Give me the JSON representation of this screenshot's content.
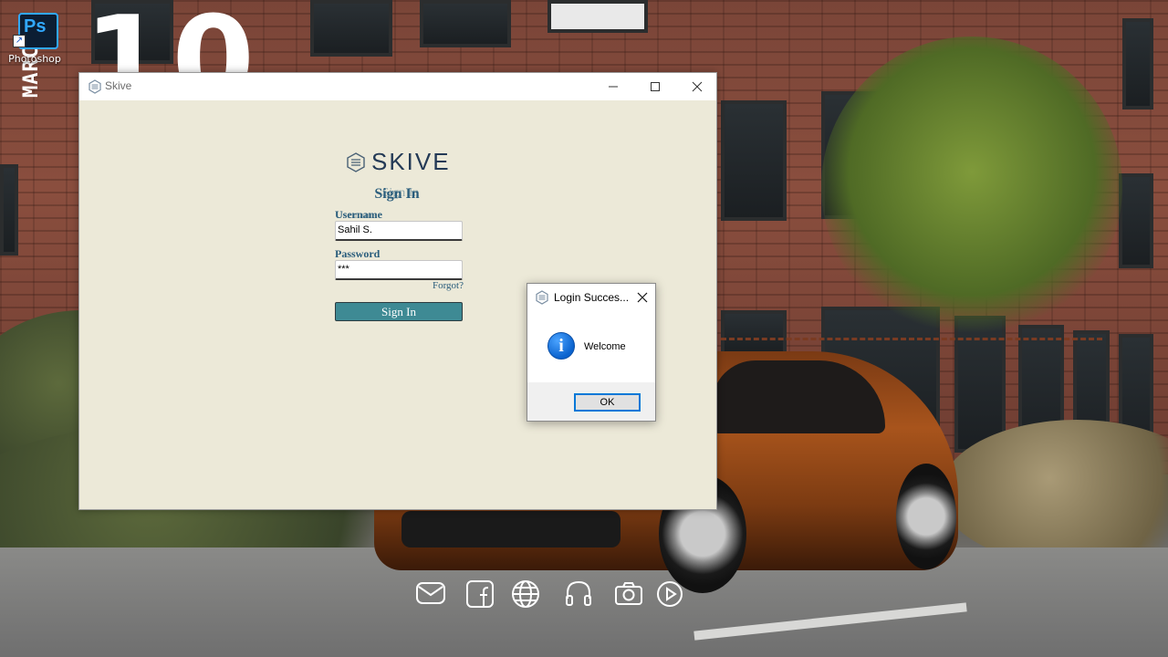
{
  "desktop": {
    "clock_big_text": "10",
    "month_text": "MARCH",
    "icons": [
      {
        "label": "Photoshop",
        "logo_text": "Ps",
        "icon": "photoshop-icon"
      }
    ],
    "dock": [
      {
        "icon": "mail-icon"
      },
      {
        "icon": "facebook-icon"
      },
      {
        "icon": "globe-icon"
      },
      {
        "icon": "headphones-icon"
      },
      {
        "icon": "camera-icon"
      },
      {
        "icon": "play-icon"
      }
    ]
  },
  "app": {
    "window_title": "Skive",
    "brand": "SKIVE",
    "heading": "Sign In",
    "username_label": "Username",
    "username_value": "Sahil S.",
    "password_label": "Password",
    "password_value": "***",
    "forgot_label": "Forgot?",
    "signin_button": "Sign In",
    "colors": {
      "background": "#ece9d8",
      "accent": "#3e8a94",
      "label_text": "#2a5d7c",
      "brand_text": "#243a56"
    }
  },
  "dialog": {
    "title": "Login Succes...",
    "message": "Welcome",
    "ok_button": "OK",
    "icon": "info-icon",
    "colors": {
      "info_icon": "#0b63ce",
      "button_focus_border": "#0078d7"
    }
  }
}
